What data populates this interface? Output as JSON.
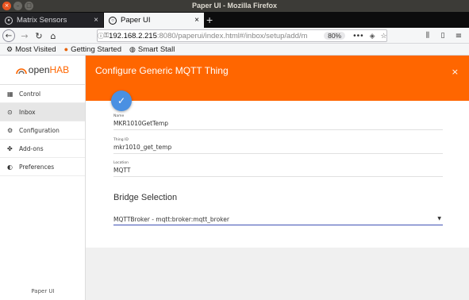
{
  "window": {
    "title": "Paper UI - Mozilla Firefox"
  },
  "tabs": [
    {
      "label": "Matrix Sensors",
      "close": "×"
    },
    {
      "label": "Paper UI",
      "close": "×"
    }
  ],
  "newtab": "+",
  "nav": {
    "back": "←",
    "forward": "→",
    "reload": "↻",
    "home": "⌂",
    "url_host": "192.168.2.215",
    "url_rest": ":8080/paperui/index.html#/inbox/setup/add/m",
    "zoom": "80%",
    "more": "•••"
  },
  "bookmarks": [
    {
      "label": "Most Visited",
      "icon": "gear-icon"
    },
    {
      "label": "Getting Started",
      "icon": "firefox-icon"
    },
    {
      "label": "Smart Stall",
      "icon": "globe-icon"
    }
  ],
  "brand": {
    "prefix": "open",
    "suffix": "HAB",
    "accent": "#ff6600"
  },
  "sidebar": {
    "items": [
      {
        "label": "Control",
        "icon": "grid-icon"
      },
      {
        "label": "Inbox",
        "icon": "inbox-icon"
      },
      {
        "label": "Configuration",
        "icon": "gear-icon"
      },
      {
        "label": "Add-ons",
        "icon": "puzzle-icon"
      },
      {
        "label": "Preferences",
        "icon": "contrast-icon"
      }
    ],
    "footer": "Paper UI"
  },
  "dialog": {
    "title": "Configure Generic MQTT Thing",
    "close": "×",
    "save": "✓"
  },
  "form": {
    "name_label": "Name",
    "name_value": "MKR1010GetTemp",
    "thingid_label": "Thing ID",
    "thingid_value": "mkr1010_get_temp",
    "location_label": "Location",
    "location_value": "MQTT",
    "bridge_title": "Bridge Selection",
    "bridge_value": "MQTTBroker - mqtt:broker:mqtt_broker"
  }
}
